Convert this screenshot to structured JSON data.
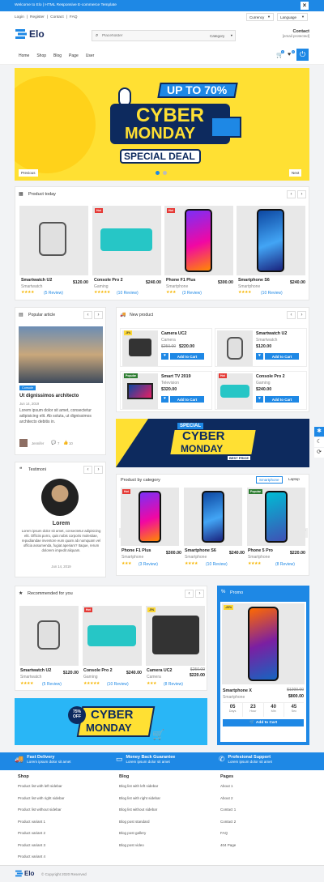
{
  "topbar": {
    "welcome": "Welcome to Elo | HTML Responsive E-commerce Template",
    "close": "×"
  },
  "header": {
    "links": [
      "Login",
      "Register",
      "Contact",
      "FAQ"
    ],
    "currency": "Currency",
    "language": "Language",
    "logo": "Elo",
    "search_placeholder": "Placeholder",
    "category": "Category",
    "contact_title": "Contact",
    "contact_email": "[email protected]",
    "nav": [
      "Home",
      "Shop",
      "Blog",
      "Page",
      "User"
    ],
    "cart_count": "0",
    "wish_count": "0"
  },
  "hero": {
    "line1": "UP TO 70%",
    "line2": "CYBER",
    "line3": "MONDAY",
    "line4": "SPECIAL DEAL",
    "prev": "Previous",
    "next": "Next"
  },
  "product_today": {
    "title": "Product today",
    "items": [
      {
        "name": "Smartwatch U2",
        "cat": "Smartwatch",
        "price": "$120.00",
        "stars": "★★★★",
        "review": "(5 Review)",
        "badge": ""
      },
      {
        "name": "Console Pro 2",
        "cat": "Gaming",
        "price": "$240.00",
        "stars": "★★★★★",
        "review": "(10 Review)",
        "badge": "Hot"
      },
      {
        "name": "Phone F1 Plus",
        "cat": "Smartphone",
        "price": "$300.00",
        "stars": "★★★",
        "review": "(3 Review)",
        "badge": "Hot"
      },
      {
        "name": "Smartphone S6",
        "cat": "Smartphone",
        "price": "$240.00",
        "stars": "★★★★",
        "review": "(10 Review)",
        "badge": ""
      }
    ]
  },
  "popular_article": {
    "title": "Popular article",
    "tag": "Console",
    "headline": "Ut dignissimos architecto",
    "date": "Jun 14, 2019",
    "body": "Lorem ipsum dolor sit amet, consectetur adipisicing elit. Ab soluta, ut dignissimos architecto debitis in.",
    "author": "Jennifer",
    "comments": "7",
    "likes": "10"
  },
  "new_product": {
    "title": "New product",
    "items": [
      {
        "name": "Camera UC2",
        "cat": "Camera",
        "old": "$250.00",
        "price": "$220.00",
        "badge": "-5%",
        "btn": "Add to Cart"
      },
      {
        "name": "Smartwatch U2",
        "cat": "Smartwatch",
        "price": "$120.00",
        "badge": "",
        "btn": "Add to Cart"
      },
      {
        "name": "Smart TV 2019",
        "cat": "Television",
        "price": "$320.00",
        "badge": "Popular",
        "btn": "Add to Cart"
      },
      {
        "name": "Console Pro 2",
        "cat": "Gaming",
        "price": "$240.00",
        "badge": "Hot",
        "btn": "Add to Cart"
      }
    ]
  },
  "banner2": {
    "line1": "SPECIAL",
    "line2": "CYBER",
    "line3": "MONDAY",
    "line4": "BEST PRICE"
  },
  "testimoni": {
    "title": "Testimoni",
    "name": "Lorem",
    "body": "Lorem ipsum dolor sit amet, consectetur adipisicing elit. Officiis porro, quis nobis corporis molestiae, repudiandae inventore eum quam ab numquam vel officia assumenda, fugiat aperiam? Itaque, rerum dolorem impedit aliquam.",
    "date": "Jun 14, 2019"
  },
  "by_category": {
    "title": "Product by category",
    "tabs": [
      "Smartphone",
      "Laptop"
    ],
    "items": [
      {
        "name": "Phone F1 Plus",
        "cat": "Smartphone",
        "price": "$300.00",
        "stars": "★★★",
        "review": "(3 Review)",
        "badge": "Hot"
      },
      {
        "name": "Smartphone S6",
        "cat": "Smartphone",
        "price": "$240.00",
        "stars": "★★★★",
        "review": "(10 Review)",
        "badge": ""
      },
      {
        "name": "Phone 5 Pro",
        "cat": "Smartphone",
        "price": "$220.00",
        "stars": "★★★★",
        "review": "(8 Review)",
        "badge": "Popular"
      }
    ]
  },
  "recommended": {
    "title": "Recommended for you",
    "items": [
      {
        "name": "Smartwatch U2",
        "cat": "Smartwatch",
        "price": "$120.00",
        "stars": "★★★★",
        "review": "(5 Review)",
        "badge": ""
      },
      {
        "name": "Console Pro 2",
        "cat": "Gaming",
        "price": "$240.00",
        "stars": "★★★★★",
        "review": "(10 Review)",
        "badge": "Hot"
      },
      {
        "name": "Camera UC2",
        "cat": "Camera",
        "old": "$250.00",
        "price": "$220.00",
        "stars": "★★★",
        "review": "(8 Review)",
        "badge": "-5%"
      }
    ]
  },
  "banner3": {
    "pct": "75%",
    "off": "OFF",
    "line1": "CYBER",
    "line2": "MONDAY"
  },
  "promo": {
    "title": "Promo",
    "badge": "-20%",
    "name": "Smartphone X",
    "cat": "Smartphone",
    "old": "$1200.00",
    "price": "$800.00",
    "countdown": [
      {
        "v": "05",
        "l": "Days"
      },
      {
        "v": "23",
        "l": "Hour"
      },
      {
        "v": "40",
        "l": "Min"
      },
      {
        "v": "45",
        "l": "Sec"
      }
    ],
    "btn": "Add to Cart"
  },
  "features": [
    {
      "title": "Fast Delivery",
      "sub": "Lorem ipsum dolor sit amet"
    },
    {
      "title": "Money Back Guarantee",
      "sub": "Lorem ipsum dolor sit amet"
    },
    {
      "title": "Profesional Support",
      "sub": "Lorem ipsum dolor sit amet"
    }
  ],
  "footer": {
    "cols": [
      {
        "title": "Shop",
        "links": [
          "Product list with left sidebar",
          "Product list with right sidebar",
          "Product list without sidebar",
          "Product variant 1",
          "Product variant 2",
          "Product variant 3",
          "Product variant 4"
        ]
      },
      {
        "title": "Blog",
        "links": [
          "Blog list with left sidebar",
          "Blog list with right sidebar",
          "Blog list without sidebar",
          "Blog post standard",
          "Blog post gallery",
          "Blog post video"
        ]
      },
      {
        "title": "Pages",
        "links": [
          "About 1",
          "About 2",
          "Contact 1",
          "Contact 2",
          "FAQ",
          "404 Page"
        ]
      }
    ],
    "logo": "Elo",
    "copyright": "© Copyright 2020 Reserved"
  },
  "colors": {
    "primary": "#1e88e5",
    "hot": "#e53935",
    "popular": "#2e7d32",
    "banner_yellow": "#ffe033",
    "navy": "#0d2a5e"
  }
}
